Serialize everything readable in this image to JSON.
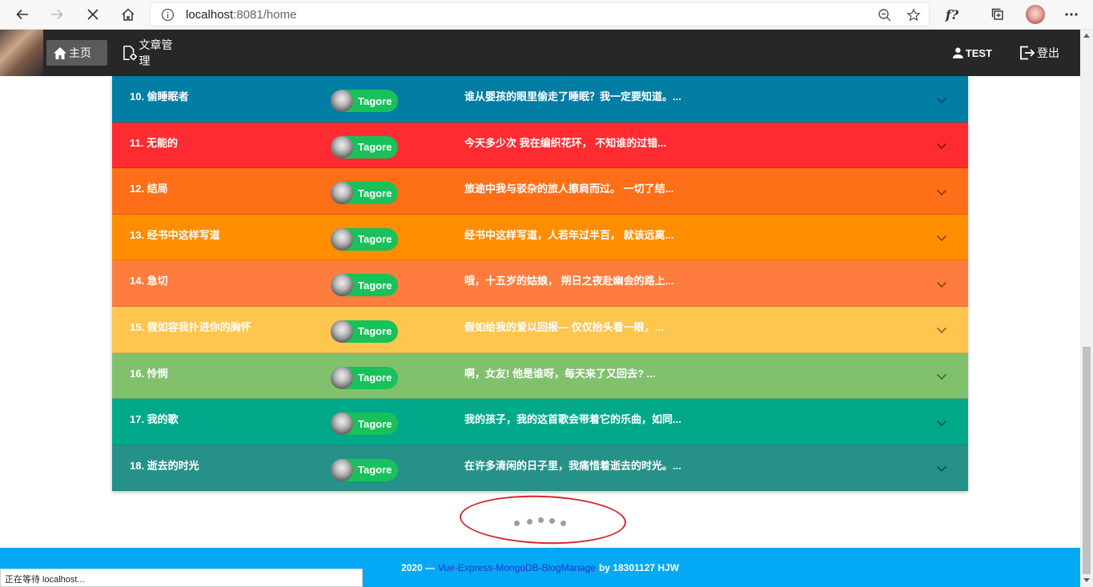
{
  "browser": {
    "url_host": "localhost",
    "url_rest": ":8081/home",
    "font_tool": "f?"
  },
  "header": {
    "home": "主页",
    "articles": "文章管理",
    "user": "TEST",
    "logout": "登出"
  },
  "colors": {
    "header_bg": "#272727",
    "chip_green": "#19c15a",
    "footer_bg": "#03a9f4"
  },
  "articles": [
    {
      "title": "10. 偷睡眠者",
      "author": "Tagore",
      "excerpt": "谁从婴孩的眼里偷走了睡眠？我一定要知道。...",
      "color": "#027ea4"
    },
    {
      "title": "11. 无能的",
      "author": "Tagore",
      "excerpt": "今天多少次 我在编织花环， 不知谁的过错...",
      "color": "#fe2b31"
    },
    {
      "title": "12. 结局",
      "author": "Tagore",
      "excerpt": "旅途中我与驳杂的旅人擦肩而过。 一切了结...",
      "color": "#fe6f17"
    },
    {
      "title": "13. 经书中这样写道",
      "author": "Tagore",
      "excerpt": "经书中这样写道，人若年过半百， 就该远离...",
      "color": "#fe8d00"
    },
    {
      "title": "14. 急切",
      "author": "Tagore",
      "excerpt": "哦，十五岁的姑娘， 朔日之夜赴幽会的路上...",
      "color": "#fe7d3e"
    },
    {
      "title": "15. 假如容我扑进你的胸怀",
      "author": "Tagore",
      "excerpt": "假如给我的爱以回报— 仅仅抬头看一眼，...",
      "color": "#fec54f"
    },
    {
      "title": "16. 怜悯",
      "author": "Tagore",
      "excerpt": "啊，女友! 他是谁呀，每天来了又回去? ...",
      "color": "#81c16e"
    },
    {
      "title": "17. 我的歌",
      "author": "Tagore",
      "excerpt": "我的孩子，我的这首歌会带着它的乐曲，如同...",
      "color": "#02a88a"
    },
    {
      "title": "18. 逝去的时光",
      "author": "Tagore",
      "excerpt": "在许多清闲的日子里，我痛惜着逝去的时光。...",
      "color": "#269189"
    }
  ],
  "footer": {
    "year": "2020 —",
    "project": "Vue-Express-MongoDB-BlogManage",
    "by": "by 18301127 HJW"
  },
  "status": {
    "text": "正在等待 localhost..."
  }
}
